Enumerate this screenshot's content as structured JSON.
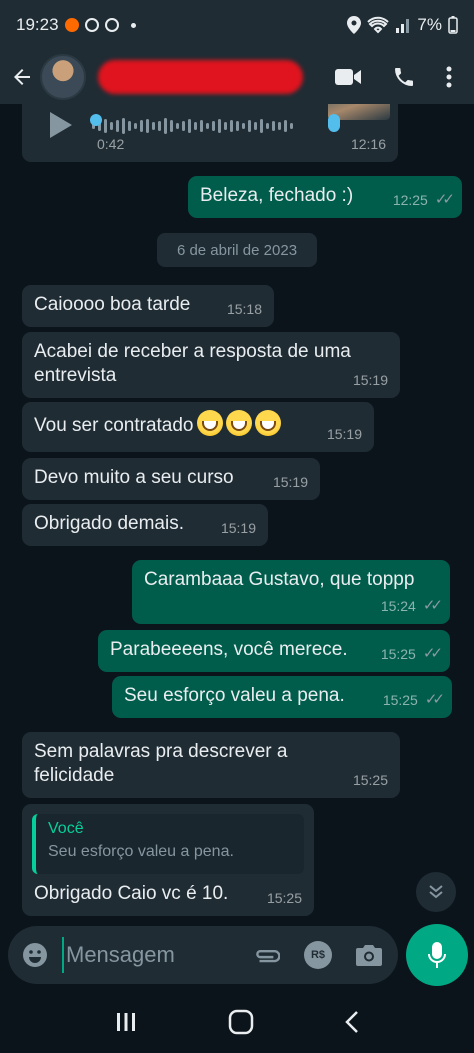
{
  "status_bar": {
    "time": "19:23",
    "battery": "7%"
  },
  "header": {
    "contact_name": ""
  },
  "voice_message": {
    "duration": "0:42",
    "time": "12:16"
  },
  "date_separator": "6 de abril de 2023",
  "messages": [
    {
      "text": "Beleza, fechado :)",
      "time": "12:25"
    },
    {
      "text": "Caioooo boa tarde",
      "time": "15:18"
    },
    {
      "text": "Acabei de receber a resposta de uma entrevista",
      "time": "15:19"
    },
    {
      "text": "Vou ser contratado",
      "time": "15:19"
    },
    {
      "text": "Devo muito a seu curso",
      "time": "15:19"
    },
    {
      "text": "Obrigado demais.",
      "time": "15:19"
    },
    {
      "text": "Carambaaa Gustavo, que toppp",
      "time": "15:24"
    },
    {
      "text": "Parabeeeens, você merece.",
      "time": "15:25"
    },
    {
      "text": "Seu esforço valeu a pena.",
      "time": "15:25"
    },
    {
      "text": "Sem palavras pra descrever a felicidade",
      "time": "15:25"
    },
    {
      "text": "Obrigado Caio vc é 10.",
      "time": "15:25"
    }
  ],
  "reply_quote": {
    "author": "Você",
    "text": "Seu esforço valeu a pena."
  },
  "input": {
    "placeholder": "Mensagem"
  },
  "colors": {
    "incoming": "#1f2c34",
    "outgoing": "#005c4b",
    "accent": "#00a884",
    "background": "#0b141a"
  },
  "icons": [
    "back-arrow-icon",
    "video-call-icon",
    "phone-icon",
    "more-vert-icon",
    "emoji-icon",
    "attach-icon",
    "payment-icon",
    "camera-icon",
    "mic-icon",
    "chevron-down-icon",
    "recents-icon",
    "home-icon",
    "nav-back-icon"
  ]
}
